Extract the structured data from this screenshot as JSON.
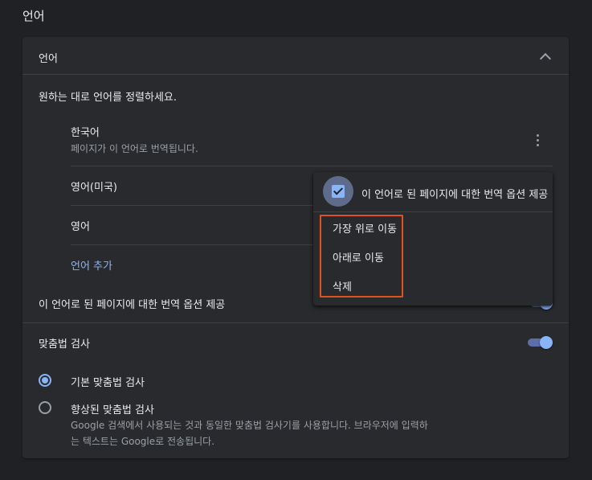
{
  "page": {
    "title": "언어"
  },
  "languages_section": {
    "title": "언어",
    "description": "원하는 대로 언어를 정렬하세요.",
    "items": [
      {
        "name": "한국어",
        "subtitle": "페이지가 이 언어로 번역됩니다."
      },
      {
        "name": "영어(미국)"
      },
      {
        "name": "영어"
      }
    ],
    "add_language_label": "언어 추가",
    "translate_option_label": "이 언어로 된 페이지에 대한 번역 옵션 제공"
  },
  "context_menu": {
    "checkbox_label": "이 언어로 된 페이지에 대한 번역 옵션 제공",
    "checkbox_checked": true,
    "items": [
      {
        "label": "가장 위로 이동"
      },
      {
        "label": "아래로 이동"
      },
      {
        "label": "삭제"
      }
    ]
  },
  "spellcheck_section": {
    "title": "맞춤법 검사",
    "enabled": true,
    "options": [
      {
        "label": "기본 맞춤법 검사",
        "selected": true
      },
      {
        "label": "향상된 맞춤법 검사",
        "selected": false,
        "description_line1": "Google 검색에서 사용되는 것과 동일한 맞춤법 검사기를 사용합니다. 브라우저에 입력하",
        "description_line2": "는 텍스트는 Google로 전송됩니다."
      }
    ]
  },
  "colors": {
    "background": "#202124",
    "card": "#292a2d",
    "accent": "#8ab4f8",
    "highlight": "#e0521c"
  }
}
